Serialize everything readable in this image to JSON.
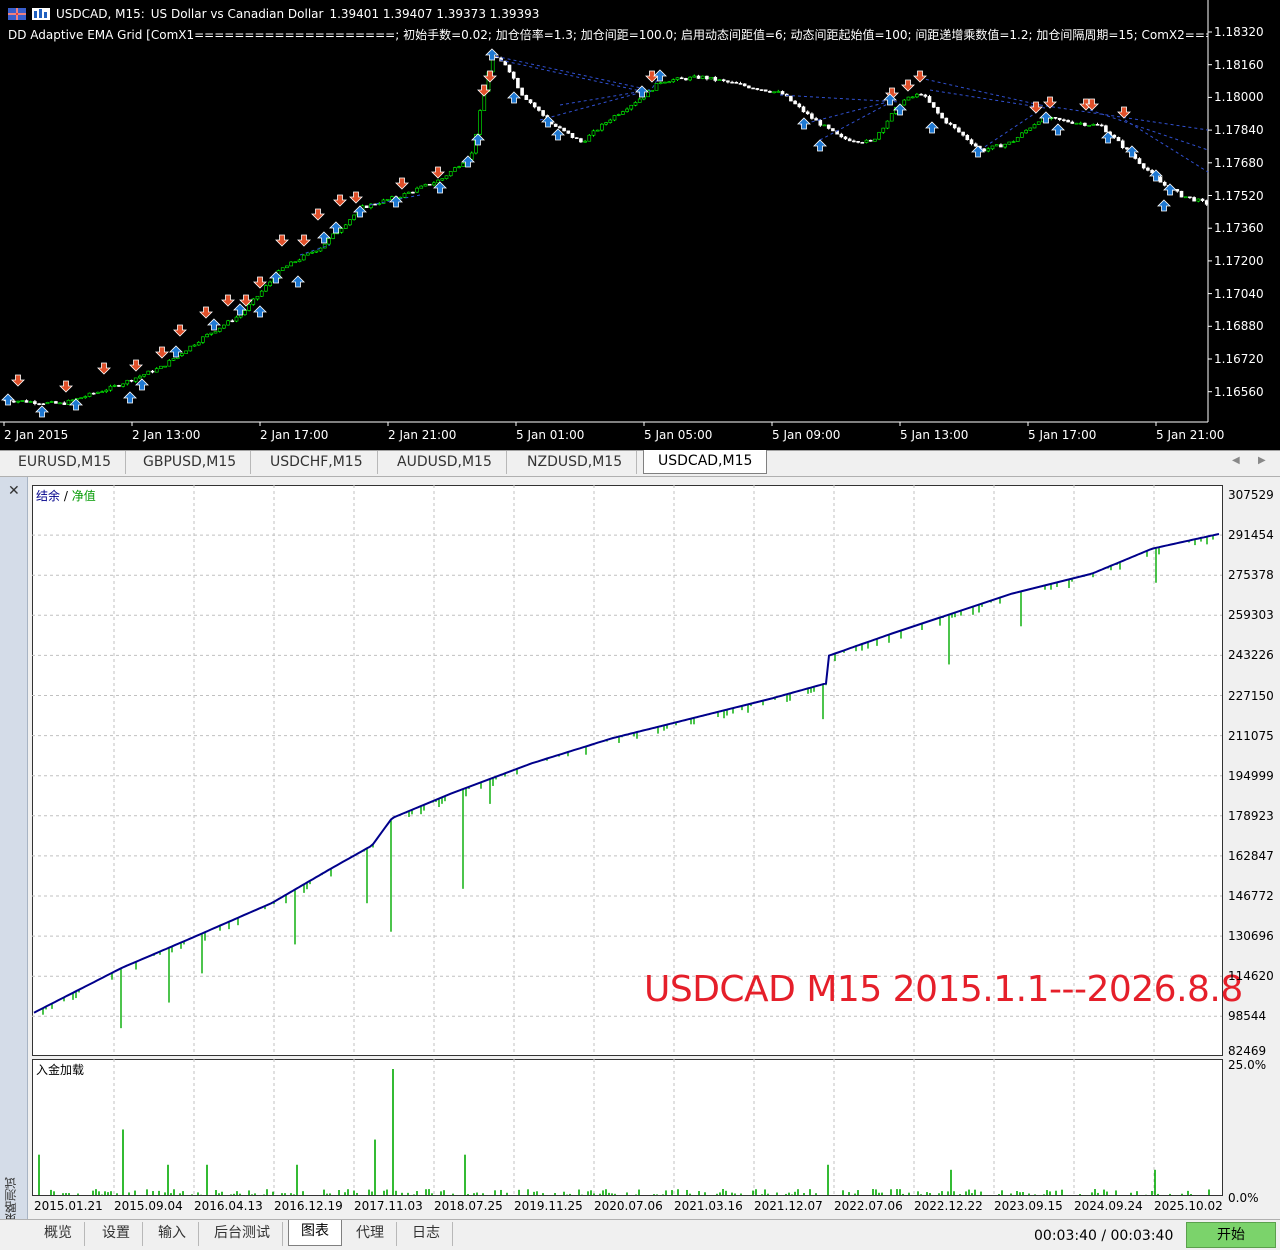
{
  "price_chart": {
    "symbol": "USDCAD, M15:",
    "description": "US Dollar vs Canadian Dollar",
    "ohlc": "1.39401 1.39407 1.39373 1.39393",
    "indicator": "DD Adaptive EMA Grid [ComX1====================; 初始手数=0.02; 加仓倍率=1.3; 加仓间距=100.0; 启用动态间距值=6; 动态间距起始值=100; 间距递增乘数值=1.2; 加仓间隔周期=15; ComX2=========",
    "price_ticks": [
      "1.18320",
      "1.18160",
      "1.18000",
      "1.17840",
      "1.17680",
      "1.17520",
      "1.17360",
      "1.17200",
      "1.17040",
      "1.16880",
      "1.16720",
      "1.16560"
    ],
    "time_ticks": [
      "2 Jan 2015",
      "2 Jan 13:00",
      "2 Jan 17:00",
      "2 Jan 21:00",
      "5 Jan 01:00",
      "5 Jan 05:00",
      "5 Jan 09:00",
      "5 Jan 13:00",
      "5 Jan 17:00",
      "5 Jan 21:00"
    ],
    "colors": {
      "bull": "#00ff00",
      "bear": "#ffffff",
      "buy_arrow": "#1e78d2",
      "sell_arrow": "#e0502a",
      "grid_line": "#3050d0"
    }
  },
  "symbol_tabs": [
    "EURUSD,M15",
    "GBPUSD,M15",
    "USDCHF,M15",
    "AUDUSD,M15",
    "NZDUSD,M15",
    "USDCAD,M15"
  ],
  "symbol_tabs_active": "USDCAD,M15",
  "tester": {
    "close_icon": "close-icon",
    "side_label": "策略测试",
    "legend_balance": "结余",
    "legend_sep": " / ",
    "legend_equity": "净值",
    "deposit_label": "入金加载",
    "overlay_title": "USDCAD M15 2015.1.1---2026.8.8",
    "equity_ticks": [
      "307529",
      "291454",
      "275378",
      "259303",
      "243226",
      "227150",
      "211075",
      "194999",
      "178923",
      "162847",
      "146772",
      "130696",
      "114620",
      "98544",
      "82469"
    ],
    "deposit_ticks": [
      "25.0%",
      "0.0%"
    ],
    "date_ticks": [
      "2015.01.21",
      "2015.09.04",
      "2016.04.13",
      "2016.12.19",
      "2017.11.03",
      "2018.07.25",
      "2019.11.25",
      "2020.07.06",
      "2021.03.16",
      "2021.12.07",
      "2022.07.06",
      "2022.12.22",
      "2023.09.15",
      "2024.09.24",
      "2025.10.02"
    ],
    "colors": {
      "balance": "#00008b",
      "equity": "#00aa00",
      "deposit": "#00aa00"
    }
  },
  "bottom_tabs": [
    "概览",
    "设置",
    "输入",
    "后台测试",
    "图表",
    "代理",
    "日志"
  ],
  "bottom_tabs_active": "图表",
  "timer": "00:03:40 / 00:03:40",
  "start_button": "开始"
}
